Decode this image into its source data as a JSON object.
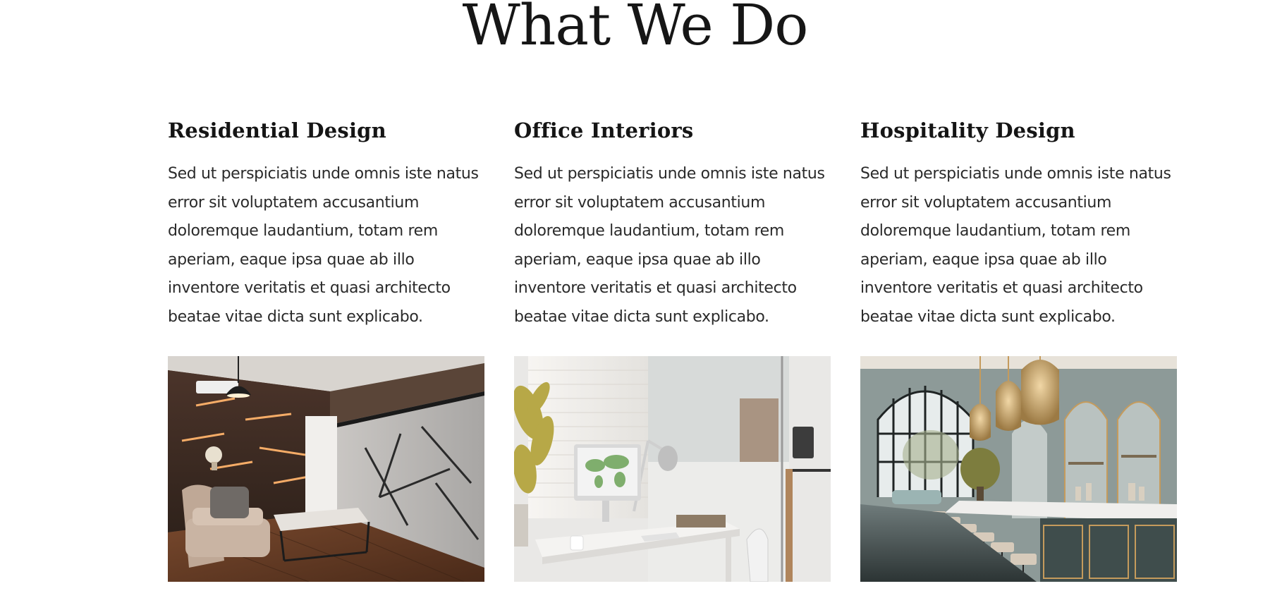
{
  "section": {
    "title": "What We Do"
  },
  "services": [
    {
      "title": "Residential Design",
      "description": "Sed ut perspiciatis unde omnis iste natus error sit voluptatem accusantium doloremque laudantium, totam rem aperiam, eaque ipsa quae ab illo inventore veritatis et quasi architecto beatae vitae dicta sunt explicabo.",
      "image": "residential-interior-photo"
    },
    {
      "title": "Office Interiors",
      "description": "Sed ut perspiciatis unde omnis iste natus error sit voluptatem accusantium doloremque laudantium, totam rem aperiam, eaque ipsa quae ab illo inventore veritatis et quasi architecto beatae vitae dicta sunt explicabo.",
      "image": "office-interior-photo"
    },
    {
      "title": "Hospitality Design",
      "description": "Sed ut perspiciatis unde omnis iste natus error sit voluptatem accusantium doloremque laudantium, totam rem aperiam, eaque ipsa quae ab illo inventore veritatis et quasi architecto beatae vitae dicta sunt explicabo.",
      "image": "hospitality-interior-photo"
    }
  ]
}
